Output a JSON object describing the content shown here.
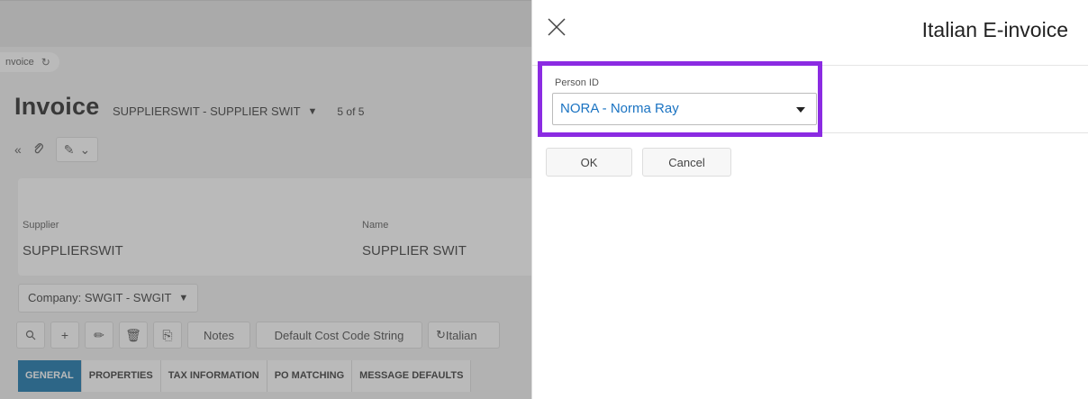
{
  "background": {
    "breadcrumb": "nvoice",
    "title": "Invoice",
    "supplier_header": "SUPPLIERSWIT - SUPPLIER SWIT",
    "record_count": "5 of 5",
    "fields": [
      {
        "label": "Supplier",
        "value": "SUPPLIERSWIT"
      },
      {
        "label": "Name",
        "value": "SUPPLIER SWIT"
      }
    ],
    "company": "Company: SWGIT - SWGIT",
    "toolbar": {
      "notes": "Notes",
      "default_cost_code": "Default Cost Code String",
      "italian": "Italian"
    },
    "tabs": [
      "GENERAL",
      "PROPERTIES",
      "TAX INFORMATION",
      "PO MATCHING",
      "MESSAGE DEFAULTS"
    ]
  },
  "dialog": {
    "title": "Italian E-invoice",
    "field_label": "Person ID",
    "field_value": "NORA - Norma Ray",
    "ok_label": "OK",
    "cancel_label": "Cancel",
    "highlight_color": "#8b2be2"
  },
  "icons": {
    "close": "close-icon",
    "refresh": "refresh-icon",
    "collapse": "double-chevron-left-icon",
    "attach": "paperclip-icon",
    "search": "search-icon",
    "add": "plus-icon",
    "edit": "pencil-icon",
    "delete": "trash-icon",
    "copy": "copy-icon",
    "dropdown": "chevron-down-icon"
  }
}
